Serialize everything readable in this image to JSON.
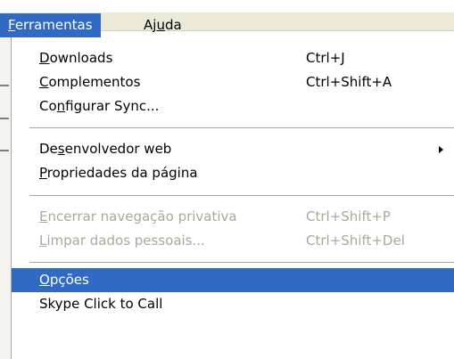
{
  "menubar": {
    "menus": [
      {
        "before": "",
        "mnemonic": "F",
        "after": "erramentas",
        "active": true
      },
      {
        "before": "Aj",
        "mnemonic": "u",
        "after": "da",
        "active": false
      }
    ]
  },
  "dropdown": {
    "items": [
      {
        "before": "",
        "mnemonic": "D",
        "after": "ownloads",
        "shortcut": "Ctrl+J"
      },
      {
        "before": "",
        "mnemonic": "C",
        "after": "omplementos",
        "shortcut": "Ctrl+Shift+A"
      },
      {
        "before": "Co",
        "mnemonic": "n",
        "after": "figurar Sync...",
        "shortcut": ""
      },
      {
        "before": "De",
        "mnemonic": "s",
        "after": "envolvedor web",
        "shortcut": ""
      },
      {
        "before": "",
        "mnemonic": "P",
        "after": "ropriedades da página",
        "shortcut": ""
      },
      {
        "before": "",
        "mnemonic": "E",
        "after": "ncerrar navegação privativa",
        "shortcut": "Ctrl+Shift+P"
      },
      {
        "before": "",
        "mnemonic": "L",
        "after": "impar dados pessoais...",
        "shortcut": "Ctrl+Shift+Del"
      },
      {
        "before": "",
        "mnemonic": "O",
        "after": "pções",
        "shortcut": ""
      },
      {
        "before": "Skype Click to Call",
        "mnemonic": "",
        "after": "",
        "shortcut": ""
      }
    ]
  },
  "colors": {
    "highlight": "#316ac5",
    "disabled_text": "#aca899",
    "menubar_bg": "#ece9d8"
  },
  "icons": {
    "submenu": "submenu-arrow-icon"
  }
}
